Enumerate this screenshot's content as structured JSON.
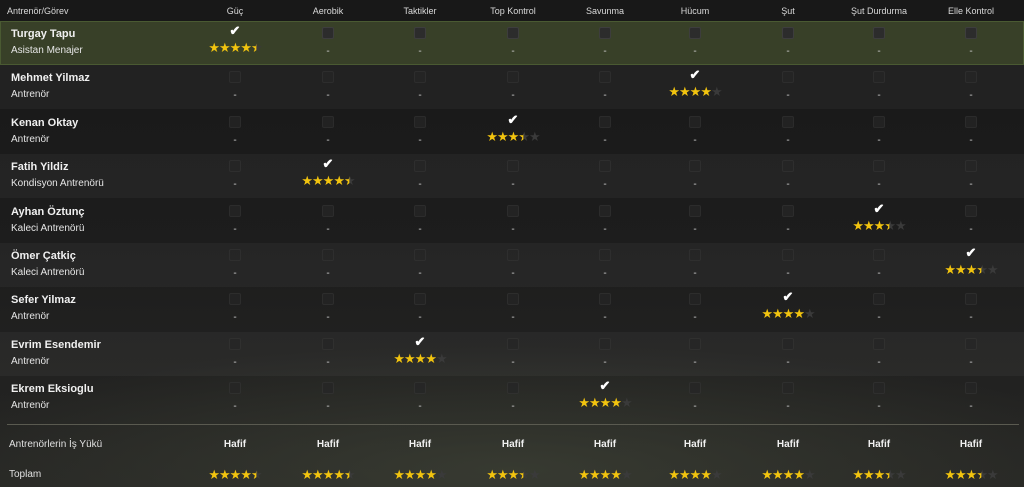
{
  "columns": {
    "first": "Antrenör/Görev",
    "items": [
      "Güç",
      "Aerobik",
      "Taktikler",
      "Top Kontrol",
      "Savunma",
      "Hücum",
      "Şut",
      "Şut Durdurma",
      "Elle Kontrol"
    ]
  },
  "coaches": [
    {
      "name": "Turgay Tapu",
      "role": "Asistan Menajer",
      "selected": true,
      "assigned": 0,
      "rating": 4.5
    },
    {
      "name": "Mehmet Yilmaz",
      "role": "Antrenör",
      "selected": false,
      "assigned": 5,
      "rating": 4
    },
    {
      "name": "Kenan Oktay",
      "role": "Antrenör",
      "selected": false,
      "assigned": 3,
      "rating": 3.5
    },
    {
      "name": "Fatih Yildiz",
      "role": "Kondisyon Antrenörü",
      "selected": false,
      "assigned": 1,
      "rating": 4.5
    },
    {
      "name": "Ayhan Öztunç",
      "role": "Kaleci Antrenörü",
      "selected": false,
      "assigned": 7,
      "rating": 3.5
    },
    {
      "name": "Ömer Çatkiç",
      "role": "Kaleci Antrenörü",
      "selected": false,
      "assigned": 8,
      "rating": 3.5
    },
    {
      "name": "Sefer Yilmaz",
      "role": "Antrenör",
      "selected": false,
      "assigned": 6,
      "rating": 4
    },
    {
      "name": "Evrim Esendemir",
      "role": "Antrenör",
      "selected": false,
      "assigned": 2,
      "rating": 4
    },
    {
      "name": "Ekrem Eksioglu",
      "role": "Antrenör",
      "selected": false,
      "assigned": 4,
      "rating": 4
    }
  ],
  "empty_cell": "-",
  "workload": {
    "label": "Antrenörlerin İş Yükü",
    "values": [
      "Hafif",
      "Hafif",
      "Hafif",
      "Hafif",
      "Hafif",
      "Hafif",
      "Hafif",
      "Hafif",
      "Hafif"
    ]
  },
  "total": {
    "label": "Toplam",
    "ratings": [
      4.5,
      4.5,
      4,
      3.5,
      4,
      4,
      4,
      3.5,
      3.5
    ]
  },
  "colors": {
    "star": "#f2c40f",
    "selected_row": "#384028"
  },
  "icons": {
    "check": "check-icon",
    "star": "star-icon",
    "checkbox": "checkbox"
  }
}
